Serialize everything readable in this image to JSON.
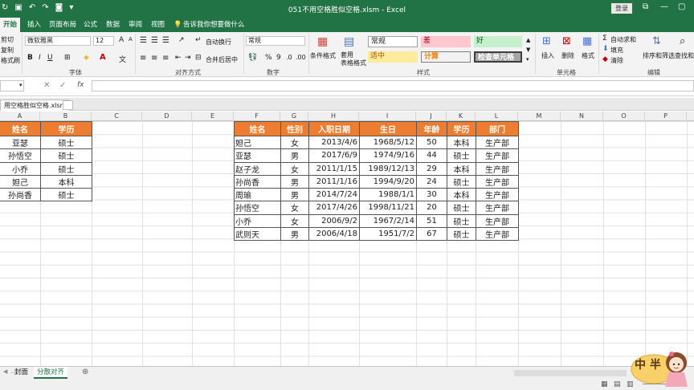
{
  "app": {
    "title": "051不用空格胜似空格.xlsm  -  Excel",
    "login_label": "登录"
  },
  "tabs": [
    "开始",
    "插入",
    "页面布局",
    "公式",
    "数据",
    "审阅",
    "视图"
  ],
  "tell_me": "告诉我你想要做什么",
  "ribbon": {
    "clipboard": {
      "cut": "剪切",
      "copy": "复制",
      "format_painter": "格式刷"
    },
    "font": {
      "name": "微软雅黑",
      "size": "12",
      "label": "字体"
    },
    "alignment": {
      "wrap": "自动换行",
      "merge": "合并后居中",
      "label": "对齐方式"
    },
    "number": {
      "format": "常规",
      "percent": "%",
      "comma": "9",
      "label": "数字"
    },
    "styles": {
      "cond_format": "条件格式",
      "table_format": "套用\n表格格式",
      "normal": "常规",
      "bad": "差",
      "good": "好",
      "neutral": "适中",
      "calc": "计算",
      "check": "检查单元格",
      "label": "样式"
    },
    "cells": {
      "insert": "插入",
      "delete": "删除",
      "format": "格式",
      "label": "单元格"
    },
    "editing": {
      "autosum": "自动求和",
      "fill": "填充",
      "clear": "清除",
      "sort": "排序和筛选",
      "find": "查找和选择",
      "label": "编辑"
    }
  },
  "formula_bar": {
    "fx": "fx",
    "content": ""
  },
  "doc_tab": "用空格胜似空格.xlsm",
  "columns": [
    "A",
    "B",
    "C",
    "D",
    "E",
    "F",
    "G",
    "H",
    "I",
    "J",
    "K",
    "L",
    "M",
    "N",
    "O",
    "P"
  ],
  "left_table": {
    "headers": [
      "姓名",
      "学历"
    ],
    "rows": [
      [
        "亚瑟",
        "硕士"
      ],
      [
        "孙悟空",
        "硕士"
      ],
      [
        "小乔",
        "硕士"
      ],
      [
        "妲己",
        "本科"
      ],
      [
        "孙尚香",
        "硕士"
      ]
    ]
  },
  "right_table": {
    "headers": [
      "姓名",
      "性别",
      "入职日期",
      "生日",
      "年龄",
      "学历",
      "部门"
    ],
    "rows": [
      [
        "妲己",
        "女",
        "2013/4/6",
        "1968/5/12",
        "50",
        "本科",
        "生产部"
      ],
      [
        "亚瑟",
        "男",
        "2017/6/9",
        "1974/9/16",
        "44",
        "硕士",
        "生产部"
      ],
      [
        "赵子龙",
        "女",
        "2011/1/15",
        "1989/12/13",
        "29",
        "本科",
        "生产部"
      ],
      [
        "孙尚香",
        "男",
        "2011/1/16",
        "1994/9/20",
        "24",
        "硕士",
        "生产部"
      ],
      [
        "周瑜",
        "男",
        "2014/7/24",
        "1988/1/1",
        "30",
        "本科",
        "生产部"
      ],
      [
        "孙悟空",
        "女",
        "2017/4/26",
        "1998/11/21",
        "20",
        "硕士",
        "生产部"
      ],
      [
        "小乔",
        "女",
        "2006/9/2",
        "1967/2/14",
        "51",
        "硕士",
        "生产部"
      ],
      [
        "武则天",
        "男",
        "2006/4/18",
        "1951/7/2",
        "67",
        "硕士",
        "生产部"
      ]
    ]
  },
  "sheets": [
    "封面",
    "分散对齐"
  ],
  "active_sheet": "分散对齐",
  "mascot_text": "中 半",
  "colors": {
    "excel_green": "#217346",
    "header_orange": "#ed7d31"
  }
}
